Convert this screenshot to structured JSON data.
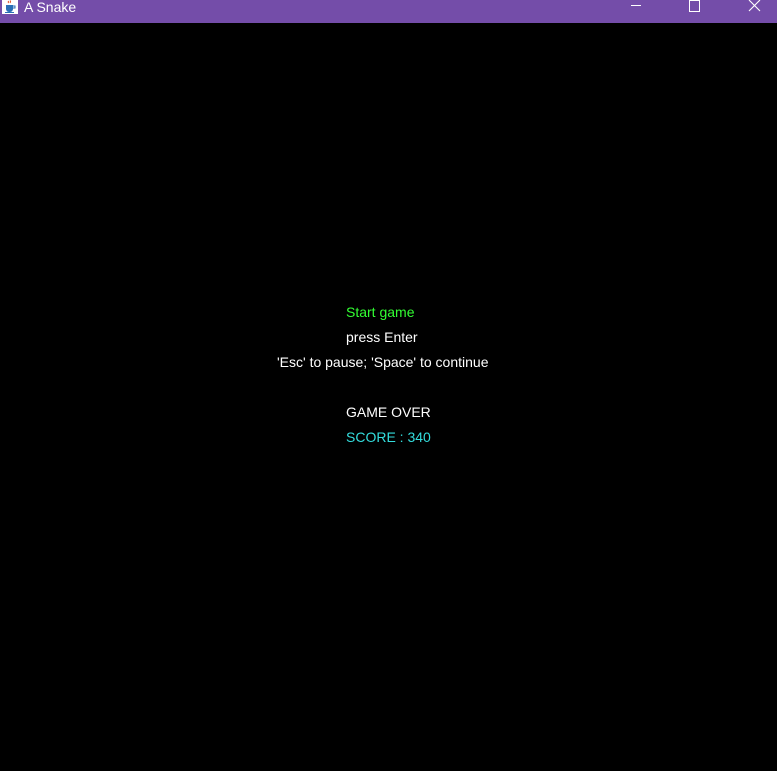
{
  "window": {
    "title": "A Snake",
    "titlebar_color": "#744da9",
    "icons": {
      "app": "java-cup-icon",
      "minimize": "minimize-icon",
      "maximize": "maximize-icon",
      "close": "close-icon"
    }
  },
  "game": {
    "background_color": "#000000",
    "start_label": "Start game",
    "start_color": "#33ff33",
    "enter_hint": "press Enter",
    "controls_hint": "'Esc' to pause; 'Space' to continue",
    "hint_color": "#ffffff",
    "game_over_label": "GAME OVER",
    "game_over_color": "#ffffff",
    "score_text": "SCORE : 340",
    "score_value": 340,
    "score_color": "#33dddd"
  }
}
